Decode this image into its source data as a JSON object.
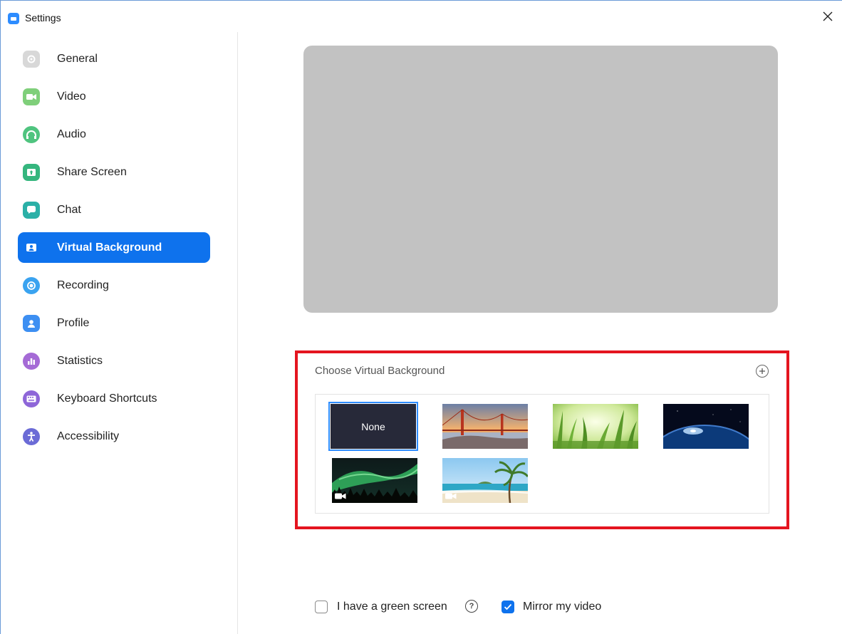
{
  "window": {
    "title": "Settings",
    "close_icon": "close-icon"
  },
  "sidebar": {
    "items": [
      {
        "label": "General",
        "icon": "gear-icon",
        "color": "#d8d8d8"
      },
      {
        "label": "Video",
        "icon": "video-camera-icon",
        "color": "#7fcf7a"
      },
      {
        "label": "Audio",
        "icon": "headphones-icon",
        "color": "#4fc47f"
      },
      {
        "label": "Share Screen",
        "icon": "share-screen-icon",
        "color": "#35b67e"
      },
      {
        "label": "Chat",
        "icon": "chat-bubble-icon",
        "color": "#2bb0a7"
      },
      {
        "label": "Virtual Background",
        "icon": "person-card-icon",
        "color": "#0e72ed",
        "active": true
      },
      {
        "label": "Recording",
        "icon": "record-icon",
        "color": "#3aa3f0"
      },
      {
        "label": "Profile",
        "icon": "user-icon",
        "color": "#3d8ff2"
      },
      {
        "label": "Statistics",
        "icon": "bar-chart-icon",
        "color": "#a56bd6"
      },
      {
        "label": "Keyboard Shortcuts",
        "icon": "keyboard-icon",
        "color": "#8e66d8"
      },
      {
        "label": "Accessibility",
        "icon": "accessibility-icon",
        "color": "#6b6bd6"
      }
    ]
  },
  "virtual_background": {
    "section_title": "Choose Virtual Background",
    "add_icon": "plus-circle-icon",
    "none_label": "None",
    "thumbnails": [
      {
        "name": "golden-gate-bridge",
        "video": false
      },
      {
        "name": "grass",
        "video": false
      },
      {
        "name": "earth-from-space",
        "video": false
      },
      {
        "name": "aurora",
        "video": true
      },
      {
        "name": "beach-palm",
        "video": true
      }
    ]
  },
  "options": {
    "green_screen_label": "I have a green screen",
    "green_screen_checked": false,
    "help_icon": "question-circle-icon",
    "mirror_label": "Mirror my video",
    "mirror_checked": true
  },
  "colors": {
    "accent": "#0e72ed",
    "highlight_border": "#e4151f",
    "preview_bg": "#c2c2c2"
  }
}
